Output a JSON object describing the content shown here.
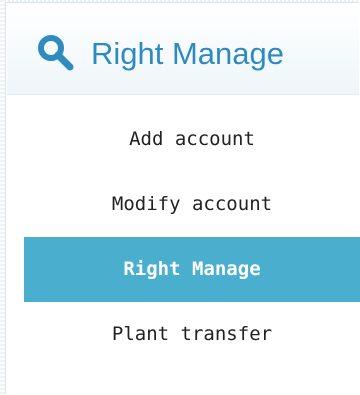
{
  "panel": {
    "title": "Right Manage",
    "title_icon": "search-icon",
    "accent_color": "#2e8bbf",
    "active_color": "#4aafcf"
  },
  "menu": {
    "items": [
      {
        "label": "Add account",
        "active": false
      },
      {
        "label": "Modify account",
        "active": false
      },
      {
        "label": "Right Manage",
        "active": true
      },
      {
        "label": "Plant transfer",
        "active": false
      }
    ]
  }
}
